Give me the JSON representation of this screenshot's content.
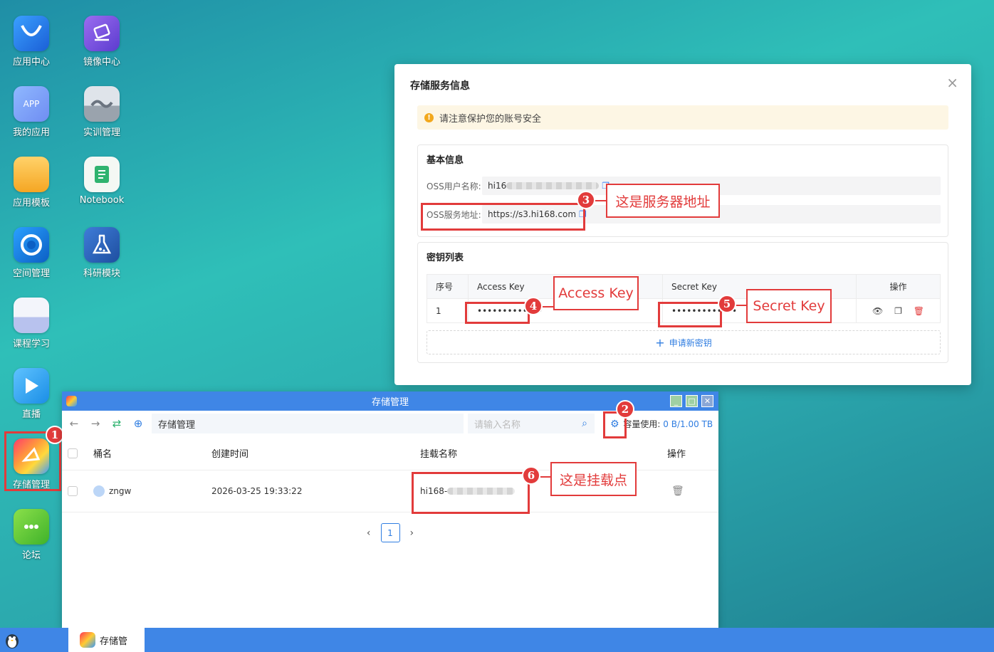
{
  "desktop": {
    "icons": [
      {
        "label": "应用中心",
        "icon": "shopping-bag-icon"
      },
      {
        "label": "镜像中心",
        "icon": "disc-icon"
      },
      {
        "label": "我的应用",
        "icon": "app-icon",
        "tile_text": "APP"
      },
      {
        "label": "实训管理",
        "icon": "wave-icon"
      },
      {
        "label": "应用模板",
        "icon": "folder-icon"
      },
      {
        "label": "Notebook",
        "icon": "notebook-icon"
      },
      {
        "label": "空间管理",
        "icon": "space-icon"
      },
      {
        "label": "科研模块",
        "icon": "flask-icon"
      },
      {
        "label": "课程学习",
        "icon": "course-icon"
      },
      {
        "label": "直播",
        "icon": "play-icon"
      },
      {
        "label": "存储管理",
        "icon": "storage-icon"
      },
      {
        "label": "论坛",
        "icon": "chat-icon"
      }
    ]
  },
  "dialog": {
    "title": "存储服务信息",
    "close": "×",
    "warning": "请注意保护您的账号安全",
    "basic": {
      "header": "基本信息",
      "user_label": "OSS用户名称:",
      "user_value": "hi16",
      "addr_label": "OSS服务地址:",
      "addr_value": "https://s3.hi168.com"
    },
    "keys": {
      "header": "密钥列表",
      "columns": [
        "序号",
        "Access Key",
        "Secret Key",
        "操作"
      ],
      "rows": [
        {
          "index": "1",
          "access": "•••••••••••••",
          "secret": "•••••••••••••"
        }
      ],
      "apply_label": "申请新密钥"
    }
  },
  "window": {
    "title": "存储管理",
    "path": "存储管理",
    "search_placeholder": "请输入名称",
    "capacity_label": "容量使用:",
    "capacity_value": "0 B/1.00 TB",
    "columns": [
      "桶名",
      "创建时间",
      "挂载名称",
      "操作"
    ],
    "rows": [
      {
        "name": "zngw",
        "created": "2026-03-25 19:33:22",
        "mount": "hi168-"
      }
    ],
    "page": "1"
  },
  "taskbar": {
    "item_label": "存储管"
  },
  "annotations": [
    {
      "num": "1"
    },
    {
      "num": "2"
    },
    {
      "num": "3",
      "text": "这是服务器地址"
    },
    {
      "num": "4",
      "text": "Access Key"
    },
    {
      "num": "5",
      "text": "Secret Key"
    },
    {
      "num": "6",
      "text": "这是挂载点"
    }
  ]
}
